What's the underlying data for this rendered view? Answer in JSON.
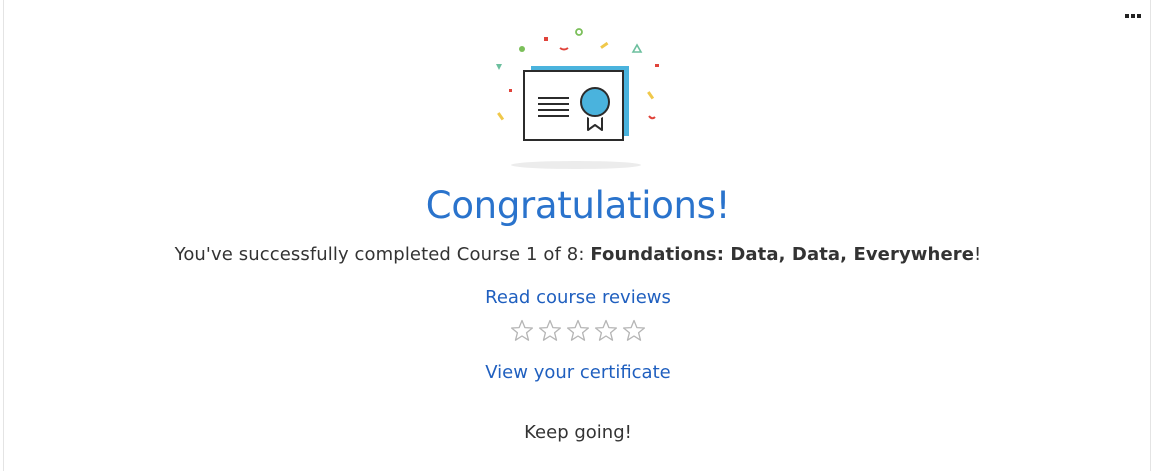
{
  "menu": {
    "icon": "more-horizontal-icon"
  },
  "illustration": {
    "icon": "certificate-icon"
  },
  "title": "Congratulations!",
  "completion": {
    "prefix": "You've successfully completed Course 1 of 8: ",
    "course_name": "Foundations: Data, Data, Everywhere",
    "suffix": "!"
  },
  "reviews_link": "Read course reviews",
  "rating": {
    "max": 5,
    "value": 0,
    "icon": "star-outline-icon"
  },
  "certificate_link": "View your certificate",
  "keep_going": "Keep going!",
  "colors": {
    "accent_blue": "#2a73cc",
    "link_blue": "#1f5fbf",
    "text": "#333333",
    "certificate_teal": "#4ab3dd"
  }
}
